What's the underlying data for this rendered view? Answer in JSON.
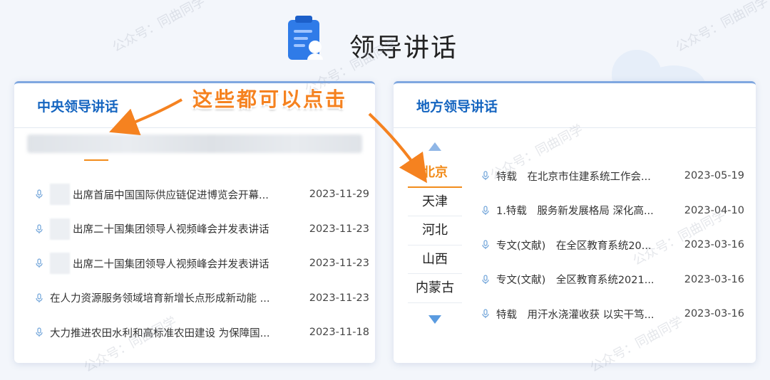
{
  "header": {
    "title": "领导讲话"
  },
  "left_panel": {
    "title": "中央领导讲话",
    "items": [
      {
        "text": "出席首届中国国际供应链促进博览会开幕...",
        "date": "2023-11-29",
        "masked": true
      },
      {
        "text": "出席二十国集团领导人视频峰会并发表讲话",
        "date": "2023-11-23",
        "masked": true
      },
      {
        "text": "出席二十国集团领导人视频峰会并发表讲话",
        "date": "2023-11-23",
        "masked": true
      },
      {
        "text": "在人力资源服务领域培育新增长点形成新动能 ...",
        "date": "2023-11-23",
        "masked": false
      },
      {
        "text": "大力推进农田水利和高标准农田建设 为保障国...",
        "date": "2023-11-18",
        "masked": false
      }
    ]
  },
  "right_panel": {
    "title": "地方领导讲话",
    "regions": [
      "北京",
      "天津",
      "河北",
      "山西",
      "内蒙古"
    ],
    "active_region": "北京",
    "items": [
      {
        "text": "特载　在北京市住建系统工作会...",
        "date": "2023-05-19"
      },
      {
        "text": "1.特载　服务新发展格局 深化高...",
        "date": "2023-04-10"
      },
      {
        "text": "专文(文献)　在全区教育系统20...",
        "date": "2023-03-16"
      },
      {
        "text": "专文(文献)　全区教育系统2021...",
        "date": "2023-03-16"
      },
      {
        "text": "特载　用汗水浇灌收获 以实干笃...",
        "date": "2023-03-16"
      }
    ]
  },
  "annotation": {
    "text": "这些都可以点击"
  },
  "watermark": {
    "text": "公众号：同曲同学"
  },
  "colors": {
    "accent": "#f28c1b",
    "title_blue": "#1565c0",
    "annotation": "#f58220"
  },
  "icons": {
    "header": "document-user-icon",
    "bullet": "microphone-icon",
    "up": "triangle-up-icon",
    "down": "triangle-down-icon"
  }
}
